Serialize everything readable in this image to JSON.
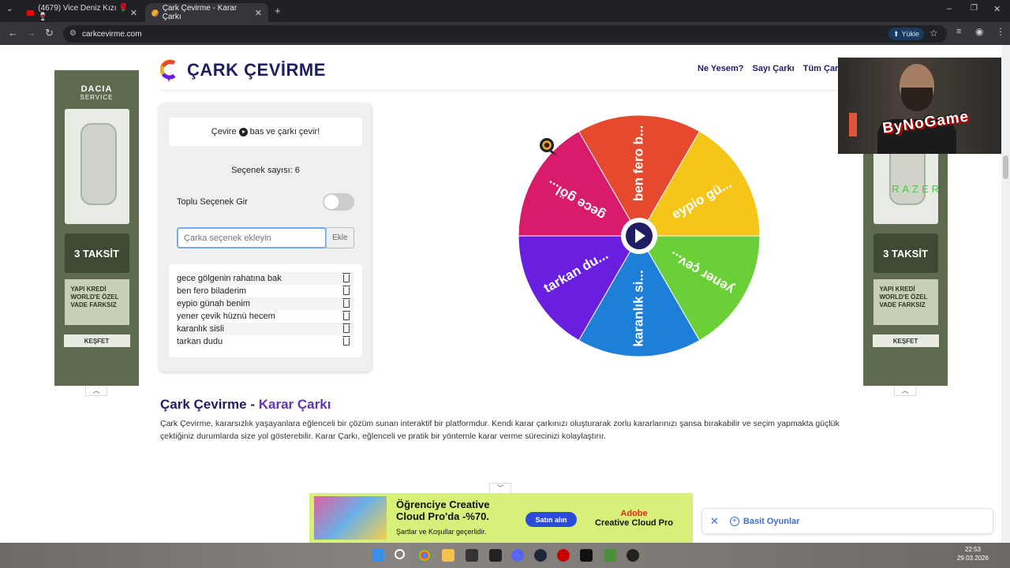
{
  "browser": {
    "tabs": [
      {
        "label": "(4679) Vice Deniz Kızı 🌹🍷",
        "active": false
      },
      {
        "label": "Çark Çevirme - Karar Çarkı",
        "active": true
      }
    ],
    "new_tab": "+",
    "url": "carkcevirme.com",
    "upload_label": "Yükle"
  },
  "header": {
    "title": "ÇARK ÇEVİRME",
    "nav": [
      "Ne Yesem?",
      "Sayı Çarkı",
      "Tüm Çarklar"
    ]
  },
  "panel": {
    "instruction_before": "Çevire",
    "instruction_after": "bas ve çarkı çevir!",
    "count_text": "Seçenek sayısı: 6",
    "bulk_label": "Toplu Seçenek Gir",
    "bulk_enabled": false,
    "input_placeholder": "Çarka seçenek ekleyin",
    "add_label": "Ekle",
    "options": [
      "gece gölgenin rahatına bak",
      "ben fero biladerim",
      "eypio günah benim",
      "yener çevik hüznü hecem",
      "karanlık sisli",
      "tarkan dudu"
    ]
  },
  "wheel": {
    "segments": [
      {
        "label": "ben fero b...",
        "color": "#e64a2e"
      },
      {
        "label": "eypio gü...",
        "color": "#f5c518"
      },
      {
        "label": "yener çev...",
        "color": "#6bd037"
      },
      {
        "label": "karanlık si...",
        "color": "#1e7fd8"
      },
      {
        "label": "tarkan du...",
        "color": "#6a1ee0"
      },
      {
        "label": "gece göl...",
        "color": "#d81b6a"
      }
    ]
  },
  "article": {
    "title_part1": "Çark Çevirme -",
    "title_part2": "Karar Çarkı",
    "body": "Çark Çevirme, kararsızlık yaşayanlara eğlenceli bir çözüm sunan interaktif bir platformdur. Kendi karar çarkınızı oluşturarak zorlu kararlarınızı şansa bırakabilir ve seçim yapmakta güçlük çektiğiniz durumlarda size yol gösterebilir. Karar Çarkı, eğlenceli ve pratik bir yöntemle karar verme sürecinizi kolaylaştırır."
  },
  "side_ads": {
    "brand": "DACIA",
    "sub": "SERVICE",
    "taksit": "3 TAKSİT",
    "promo": "YAPI KREDİ WORLD'E ÖZEL VADE FARKSIZ",
    "cta": "KEŞFET"
  },
  "bottom_ad": {
    "headline": "Öğrenciye Creative Cloud Pro'da -%70.",
    "small": "Şartlar ve Koşullar geçerlidir.",
    "button": "Satın alın",
    "brand_line1": "Adobe",
    "brand_line2": "Creative Cloud Pro"
  },
  "simple_games": {
    "label": "Basit Oyunlar"
  },
  "overlay": {
    "streamer": "ByNoGame",
    "razer": "RAZER"
  },
  "taskbar": {
    "time": "22:53",
    "date": "29.03.2026"
  }
}
